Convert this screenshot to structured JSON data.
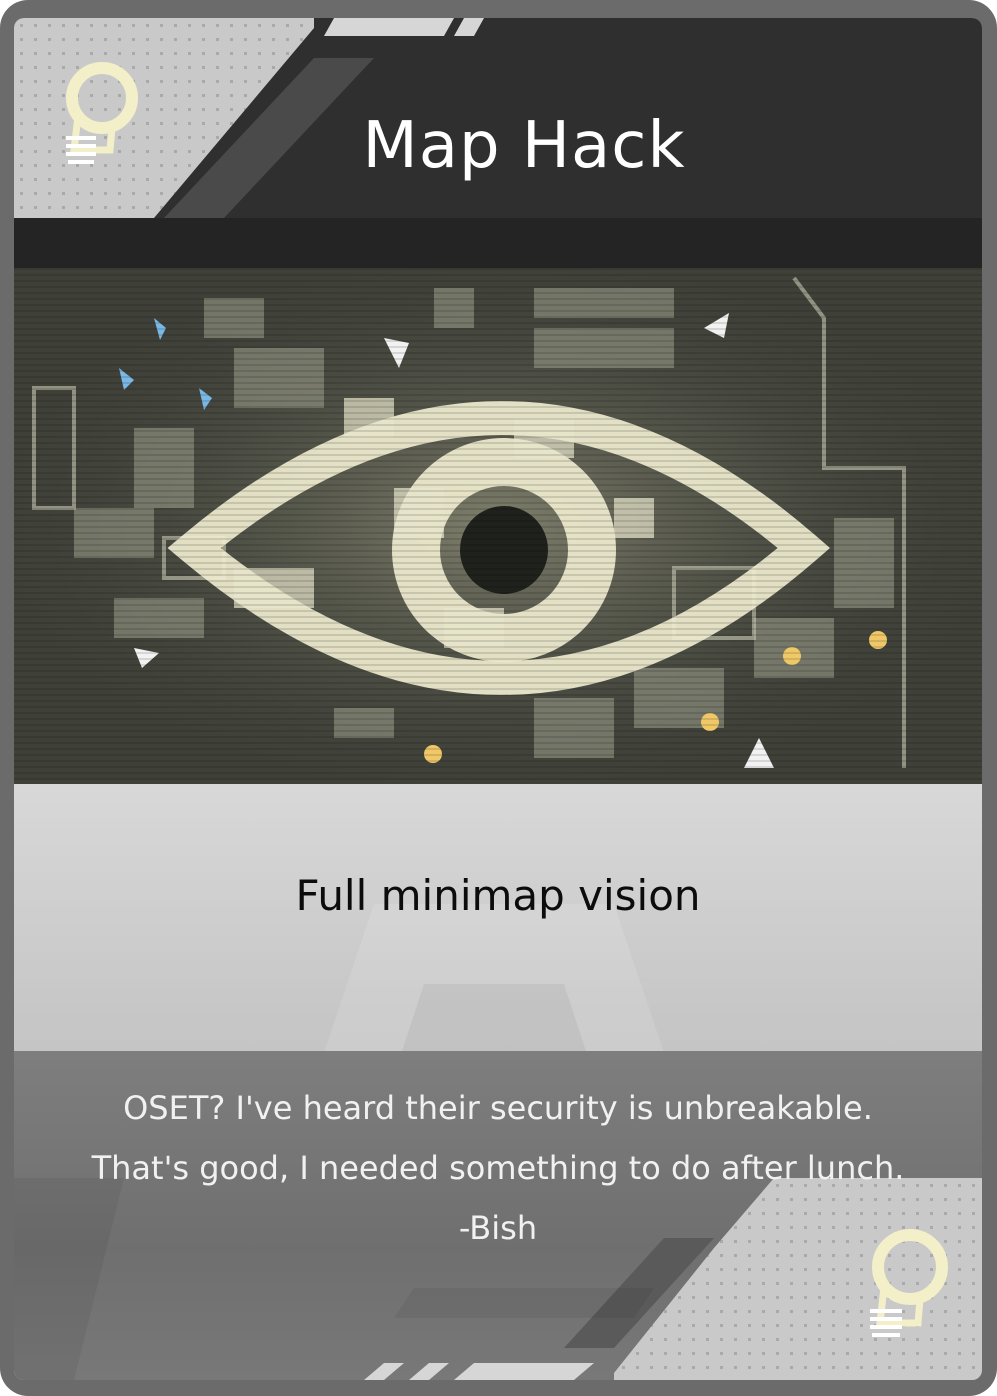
{
  "card": {
    "title": "Map Hack",
    "effect": "Full minimap vision",
    "flavor_lines": [
      "OSET? I've heard their security is unbreakable.",
      "That's good, I needed something to do after lunch.",
      "-Bish"
    ],
    "icon_top": "lightbulb-icon",
    "icon_bottom": "lightbulb-icon",
    "art": "eye-over-minimap-illustration"
  },
  "colors": {
    "frame": "#6b6b6b",
    "header": "#2f2f2f",
    "body": "#c6c6c6",
    "flavor_band": "#737373",
    "accent_eye": "#efeccf",
    "marker_blue": "#7ab8e6",
    "marker_gold": "#f0c868"
  }
}
